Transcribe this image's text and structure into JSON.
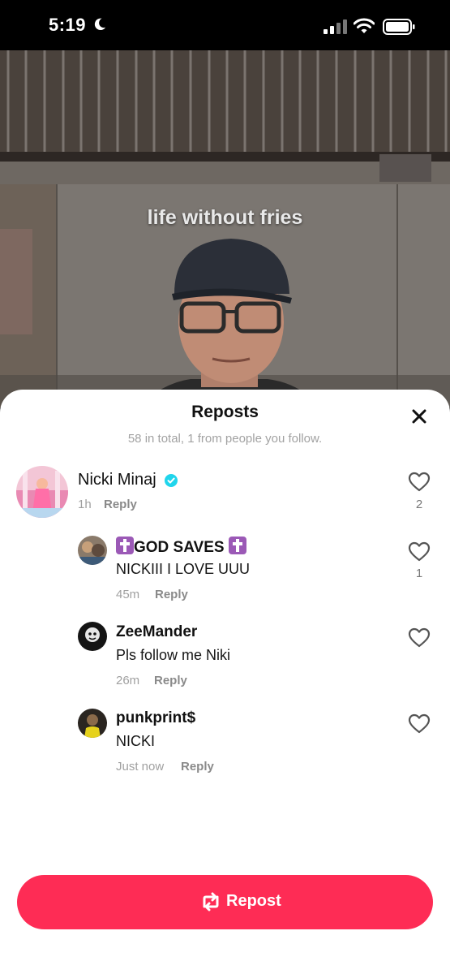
{
  "status_bar": {
    "time": "5:19"
  },
  "video": {
    "caption": "life without fries"
  },
  "sheet": {
    "title": "Reposts",
    "subtitle": "58 in total, 1 from people you follow."
  },
  "comments": [
    {
      "username": "Nicki Minaj",
      "verified": true,
      "time": "1h",
      "reply": "Reply",
      "likes": "2"
    },
    {
      "username": "GOD SAVES",
      "text": "NICKIII I LOVE UUU",
      "time": "45m",
      "reply": "Reply",
      "likes": "1"
    },
    {
      "username": "ZeeMander",
      "text": "Pls follow me Niki",
      "time": "26m",
      "reply": "Reply"
    },
    {
      "username": "punkprint$",
      "text": "NICKI",
      "time": "Just now",
      "reply": "Reply"
    }
  ],
  "repost_button": {
    "label": "Repost"
  },
  "colors": {
    "accent": "#fe2c55",
    "verified": "#20d5ec"
  }
}
